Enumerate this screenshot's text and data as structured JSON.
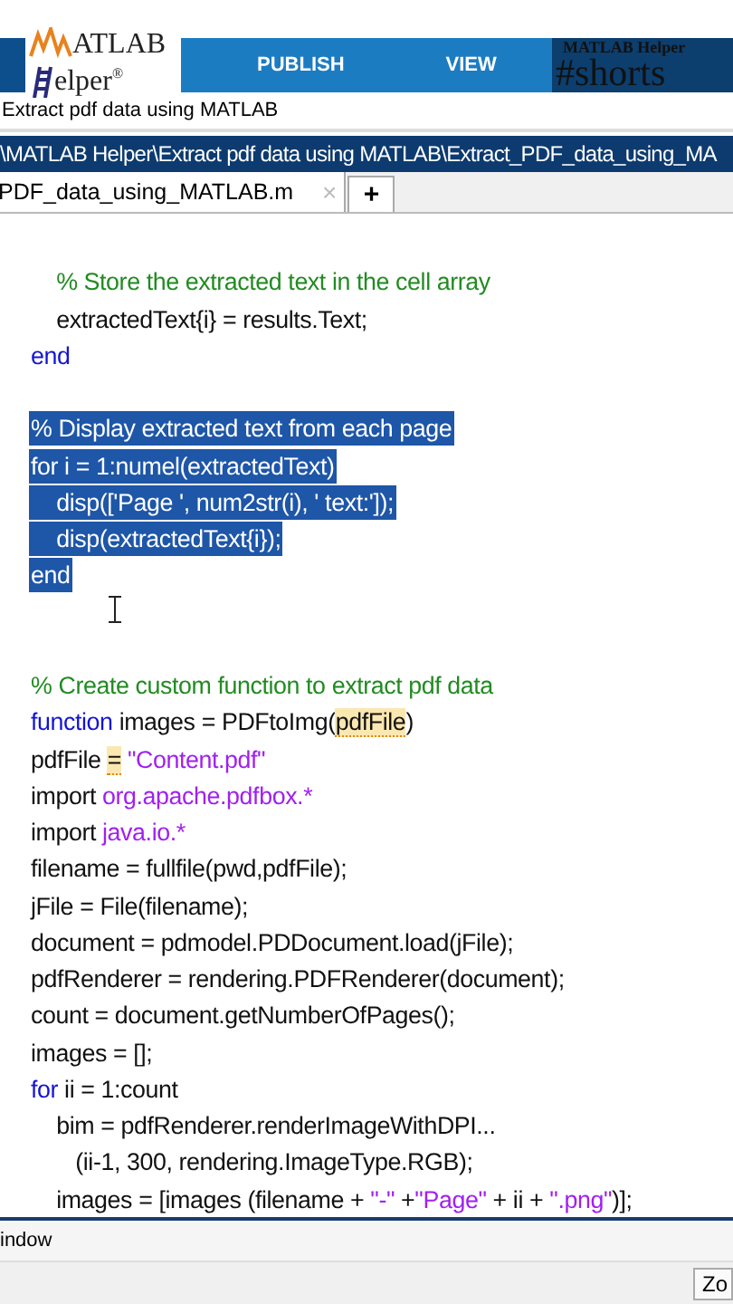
{
  "branding": {
    "logo_top": "ATLAB",
    "logo_bottom": "elper",
    "logo_mark": "®",
    "channel": "MATLAB Helper",
    "hashtag": "#shorts"
  },
  "ribbon": {
    "tabs": [
      {
        "label": "PUBLISH",
        "selected": false
      },
      {
        "label": "VIEW",
        "selected": false
      }
    ]
  },
  "window": {
    "title": "Extract pdf data using MATLAB"
  },
  "path_bar": {
    "path": "\\MATLAB Helper\\Extract pdf data using MATLAB\\Extract_PDF_data_using_MA"
  },
  "editor_tabs": [
    {
      "label": "PDF_data_using_MATLAB.m",
      "close": "×",
      "selected": true
    }
  ],
  "new_tab": "+",
  "code_lines": [
    {
      "kind": "blank"
    },
    {
      "kind": "code",
      "selected": false,
      "tokens": [
        {
          "kind": "comment",
          "text": "    % Store the extracted text in the cell array"
        }
      ]
    },
    {
      "selected": false,
      "tokens": [
        {
          "kind": "plain",
          "text": "    extractedText{i} = results.Text;"
        }
      ]
    },
    {
      "selected": false,
      "tokens": [
        {
          "kind": "keyword",
          "text": "end"
        }
      ]
    },
    {
      "kind": "blank"
    },
    {
      "selected": true,
      "tokens": [
        {
          "kind": "comment",
          "text": "% Display extracted text from each page"
        }
      ]
    },
    {
      "selected": true,
      "tokens": [
        {
          "kind": "keyword",
          "text": "for"
        },
        {
          "kind": "plain",
          "text": " i = 1:numel(extractedText)"
        }
      ]
    },
    {
      "selected": true,
      "tokens": [
        {
          "kind": "plain",
          "text": "    disp(['Page ', num2str(i), ' text:']);"
        }
      ]
    },
    {
      "selected": true,
      "tokens": [
        {
          "kind": "plain",
          "text": "    disp(extractedText{i});"
        }
      ]
    },
    {
      "selected": true,
      "tokens": [
        {
          "kind": "keyword",
          "text": "end"
        }
      ]
    },
    {
      "kind": "blank"
    },
    {
      "kind": "blank"
    },
    {
      "selected": false,
      "tokens": [
        {
          "kind": "comment",
          "text": "% Create custom function to extract pdf data"
        }
      ]
    },
    {
      "selected": false,
      "tokens": [
        {
          "kind": "keyword",
          "text": "function"
        },
        {
          "kind": "plain",
          "text": " images = PDFtoImg("
        },
        {
          "kind": "plain",
          "text": "pdfFile",
          "flagged": true
        },
        {
          "kind": "plain",
          "text": ")"
        }
      ]
    },
    {
      "selected": false,
      "tokens": [
        {
          "kind": "plain",
          "text": "pdfFile "
        },
        {
          "kind": "plain",
          "text": "=",
          "flagged": true
        },
        {
          "kind": "string",
          "text": " \"Content.pdf\""
        }
      ]
    },
    {
      "selected": false,
      "tokens": [
        {
          "kind": "plain",
          "text": "import "
        },
        {
          "kind": "string",
          "text": "org.apache.pdfbox.*"
        }
      ]
    },
    {
      "selected": false,
      "tokens": [
        {
          "kind": "plain",
          "text": "import "
        },
        {
          "kind": "string",
          "text": "java.io.*"
        }
      ]
    },
    {
      "selected": false,
      "tokens": [
        {
          "kind": "plain",
          "text": "filename = fullfile(pwd,pdfFile);"
        }
      ]
    },
    {
      "selected": false,
      "tokens": [
        {
          "kind": "plain",
          "text": "jFile = File(filename);"
        }
      ]
    },
    {
      "selected": false,
      "tokens": [
        {
          "kind": "plain",
          "text": "document = pdmodel.PDDocument.load(jFile);"
        }
      ]
    },
    {
      "selected": false,
      "tokens": [
        {
          "kind": "plain",
          "text": "pdfRenderer = rendering.PDFRenderer(document);"
        }
      ]
    },
    {
      "selected": false,
      "tokens": [
        {
          "kind": "plain",
          "text": "count = document.getNumberOfPages();"
        }
      ]
    },
    {
      "selected": false,
      "tokens": [
        {
          "kind": "plain",
          "text": "images = [];"
        }
      ]
    },
    {
      "selected": false,
      "tokens": [
        {
          "kind": "keyword",
          "text": "for"
        },
        {
          "kind": "plain",
          "text": " ii = 1:count"
        }
      ]
    },
    {
      "selected": false,
      "tokens": [
        {
          "kind": "plain",
          "text": "    bim = pdfRenderer.renderImageWithDPI..."
        }
      ]
    },
    {
      "selected": false,
      "tokens": [
        {
          "kind": "plain",
          "text": "       (ii-1, 300, rendering.ImageType.RGB);"
        }
      ]
    },
    {
      "selected": false,
      "tokens": [
        {
          "kind": "plain",
          "text": "    images = [images (filename + "
        },
        {
          "kind": "string",
          "text": "\"-\""
        },
        {
          "kind": "plain",
          "text": " +"
        },
        {
          "kind": "string",
          "text": "\"Page\""
        },
        {
          "kind": "plain",
          "text": " + ii + "
        },
        {
          "kind": "string",
          "text": "\".png\""
        },
        {
          "kind": "plain",
          "text": ")];"
        }
      ]
    }
  ],
  "panel": {
    "title": "indow",
    "button": "Zo"
  }
}
